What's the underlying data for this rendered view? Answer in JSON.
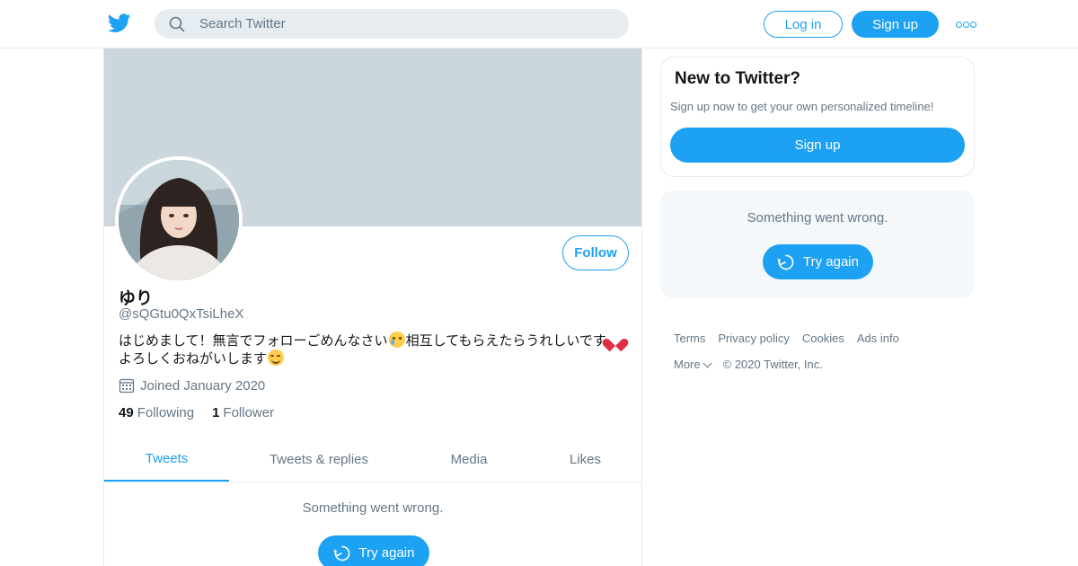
{
  "header": {
    "search_placeholder": "Search Twitter",
    "login_label": "Log in",
    "signup_label": "Sign up"
  },
  "profile": {
    "display_name": "ゆり",
    "handle": "@sQGtu0QxTsiLheX",
    "follow_label": "Follow",
    "bio_part1": "はじめまして！無言でフォローごめんなさい",
    "bio_part2": "相互してもらえたらうれしいです",
    "bio_part3": "よろしくおねがいします",
    "joined": "Joined January 2020",
    "following_count": "49",
    "following_label": "Following",
    "followers_count": "1",
    "followers_label": "Follower"
  },
  "tabs": [
    {
      "label": "Tweets",
      "active": true
    },
    {
      "label": "Tweets & replies",
      "active": false
    },
    {
      "label": "Media",
      "active": false
    },
    {
      "label": "Likes",
      "active": false
    }
  ],
  "timeline": {
    "error_text": "Something went wrong.",
    "retry_label": "Try again"
  },
  "sidebar": {
    "new_title": "New to Twitter?",
    "new_subtitle": "Sign up now to get your own personalized timeline!",
    "signup_label": "Sign up",
    "error_text": "Something went wrong.",
    "retry_label": "Try again"
  },
  "footer": {
    "links": [
      "Terms",
      "Privacy policy",
      "Cookies",
      "Ads info"
    ],
    "more_label": "More",
    "copyright": "© 2020 Twitter, Inc."
  },
  "colors": {
    "accent": "#1da1f2",
    "banner": "#ccd6dd",
    "muted_text": "#657786",
    "border": "#e6ecf0"
  },
  "icons": [
    "twitter-bird-icon",
    "search-icon",
    "more-icon",
    "calendar-icon",
    "refresh-icon",
    "chevron-down-icon",
    "crying-face-emoji",
    "heart-emoji",
    "smiling-face-emoji"
  ]
}
